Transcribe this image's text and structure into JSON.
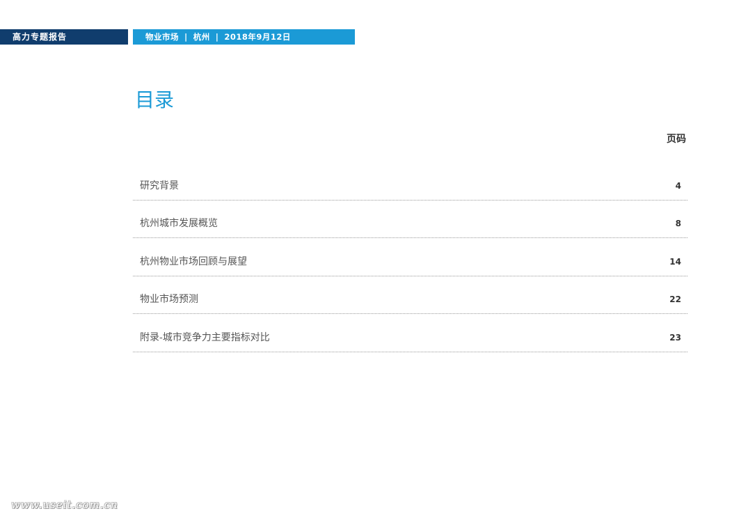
{
  "header": {
    "report_label": "高力专题报告",
    "topic": "物业市场",
    "city": "杭州",
    "date": "2018年9月12日",
    "separator": "|"
  },
  "toc": {
    "title": "目录",
    "page_column_label": "页码",
    "items": [
      {
        "label": "研究背景",
        "page": "4"
      },
      {
        "label": "杭州城市发展概览",
        "page": "8"
      },
      {
        "label": "杭州物业市场回顾与展望",
        "page": "14"
      },
      {
        "label": "物业市场预测",
        "page": "22"
      },
      {
        "label": "附录-城市竞争力主要指标对比",
        "page": "23"
      }
    ]
  },
  "watermark": "www.useit.com.cn",
  "colors": {
    "navy": "#103d6d",
    "accent_blue": "#1b9ad6"
  }
}
